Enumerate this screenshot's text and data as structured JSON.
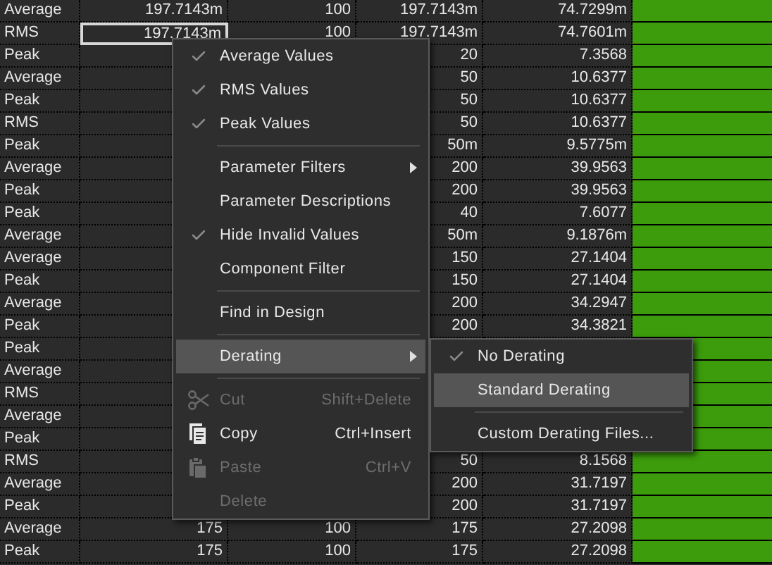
{
  "table": {
    "rows": [
      {
        "cells": [
          "Average",
          "197.7143m",
          "100",
          "197.7143m",
          "74.7299m"
        ],
        "selected": false
      },
      {
        "cells": [
          "RMS",
          "197.7143m",
          "100",
          "197.7143m",
          "74.7601m"
        ],
        "selected": true
      },
      {
        "cells": [
          "Peak",
          null,
          null,
          "20",
          "7.3568"
        ],
        "selected": false
      },
      {
        "cells": [
          "Average",
          null,
          null,
          "50",
          "10.6377"
        ],
        "selected": false
      },
      {
        "cells": [
          "Peak",
          null,
          null,
          "50",
          "10.6377"
        ],
        "selected": false
      },
      {
        "cells": [
          "RMS",
          null,
          null,
          "50",
          "10.6377"
        ],
        "selected": false
      },
      {
        "cells": [
          "Peak",
          null,
          null,
          "50m",
          "9.5775m"
        ],
        "selected": false
      },
      {
        "cells": [
          "Average",
          null,
          null,
          "200",
          "39.9563"
        ],
        "selected": false
      },
      {
        "cells": [
          "Peak",
          null,
          null,
          "200",
          "39.9563"
        ],
        "selected": false
      },
      {
        "cells": [
          "Peak",
          null,
          null,
          "40",
          "7.6077"
        ],
        "selected": false
      },
      {
        "cells": [
          "Average",
          null,
          null,
          "50m",
          "9.1876m"
        ],
        "selected": false
      },
      {
        "cells": [
          "Average",
          null,
          null,
          "150",
          "27.1404"
        ],
        "selected": false
      },
      {
        "cells": [
          "Peak",
          null,
          null,
          "150",
          "27.1404"
        ],
        "selected": false
      },
      {
        "cells": [
          "Average",
          null,
          null,
          "200",
          "34.2947"
        ],
        "selected": false
      },
      {
        "cells": [
          "Peak",
          null,
          null,
          "200",
          "34.3821"
        ],
        "selected": false
      },
      {
        "cells": [
          "Peak",
          null,
          null,
          null,
          null
        ],
        "selected": false
      },
      {
        "cells": [
          "Average",
          null,
          null,
          null,
          null
        ],
        "selected": false
      },
      {
        "cells": [
          "RMS",
          null,
          null,
          null,
          null
        ],
        "selected": false
      },
      {
        "cells": [
          "Average",
          null,
          null,
          null,
          null
        ],
        "selected": false
      },
      {
        "cells": [
          "Peak",
          null,
          null,
          null,
          null
        ],
        "selected": false
      },
      {
        "cells": [
          "RMS",
          null,
          null,
          "50",
          "8.1568"
        ],
        "selected": false
      },
      {
        "cells": [
          "Average",
          null,
          null,
          "200",
          "31.7197"
        ],
        "selected": false
      },
      {
        "cells": [
          "Peak",
          null,
          null,
          "200",
          "31.7197"
        ],
        "selected": false
      },
      {
        "cells": [
          "Average",
          "175",
          "100",
          "175",
          "27.2098"
        ],
        "selected": false
      },
      {
        "cells": [
          "Peak",
          "175",
          "100",
          "175",
          "27.2098"
        ],
        "selected": false
      }
    ]
  },
  "context_menu": {
    "items": [
      {
        "kind": "item",
        "label": "Average Values",
        "checked": true,
        "submenu": false,
        "disabled": false,
        "selected": false
      },
      {
        "kind": "item",
        "label": "RMS Values",
        "checked": true,
        "submenu": false,
        "disabled": false,
        "selected": false
      },
      {
        "kind": "item",
        "label": "Peak Values",
        "checked": true,
        "submenu": false,
        "disabled": false,
        "selected": false
      },
      {
        "kind": "separator"
      },
      {
        "kind": "item",
        "label": "Parameter Filters",
        "checked": false,
        "submenu": true,
        "disabled": false,
        "selected": false
      },
      {
        "kind": "item",
        "label": "Parameter Descriptions",
        "checked": false,
        "submenu": false,
        "disabled": false,
        "selected": false
      },
      {
        "kind": "item",
        "label": "Hide Invalid Values",
        "checked": true,
        "submenu": false,
        "disabled": false,
        "selected": false
      },
      {
        "kind": "item",
        "label": "Component Filter",
        "checked": false,
        "submenu": false,
        "disabled": false,
        "selected": false
      },
      {
        "kind": "separator"
      },
      {
        "kind": "item",
        "label": "Find in Design",
        "checked": false,
        "submenu": false,
        "disabled": false,
        "selected": false
      },
      {
        "kind": "separator"
      },
      {
        "kind": "item",
        "label": "Derating",
        "checked": false,
        "submenu": true,
        "disabled": false,
        "selected": true
      },
      {
        "kind": "separator"
      },
      {
        "kind": "cut",
        "label": "Cut",
        "shortcut": "Shift+Delete",
        "disabled": true,
        "selected": false
      },
      {
        "kind": "copy",
        "label": "Copy",
        "shortcut": "Ctrl+Insert",
        "disabled": false,
        "selected": false
      },
      {
        "kind": "paste",
        "label": "Paste",
        "shortcut": "Ctrl+V",
        "disabled": true,
        "selected": false
      },
      {
        "kind": "item",
        "label": "Delete",
        "checked": false,
        "submenu": false,
        "disabled": true,
        "selected": false
      }
    ]
  },
  "submenu": {
    "items": [
      {
        "kind": "item",
        "label": "No Derating",
        "checked": true,
        "selected": false
      },
      {
        "kind": "item",
        "label": "Standard Derating",
        "checked": false,
        "selected": true
      },
      {
        "kind": "separator"
      },
      {
        "kind": "item",
        "label": "Custom Derating Files...",
        "checked": false,
        "selected": false
      }
    ]
  }
}
